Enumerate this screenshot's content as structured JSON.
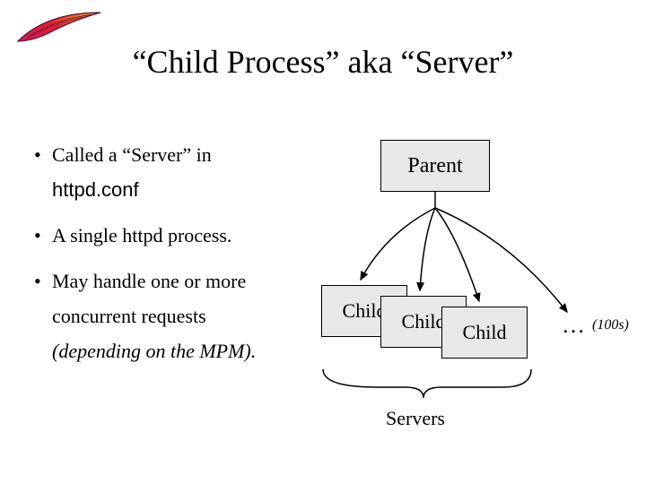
{
  "title": "“Child Process” aka “Server”",
  "bullets": {
    "b1_line1": "Called a “Server” in",
    "b1_line2": "httpd.conf",
    "b2": "A single httpd process.",
    "b3_line1": "May handle one or more",
    "b3_line2": "concurrent requests",
    "b3_line3": "(depending on the MPM)."
  },
  "diagram": {
    "parent": "Parent",
    "child1": "Child",
    "child2": "Child",
    "child3": "Child",
    "ellipsis": "…",
    "hundreds": "(100s)",
    "servers": "Servers"
  }
}
